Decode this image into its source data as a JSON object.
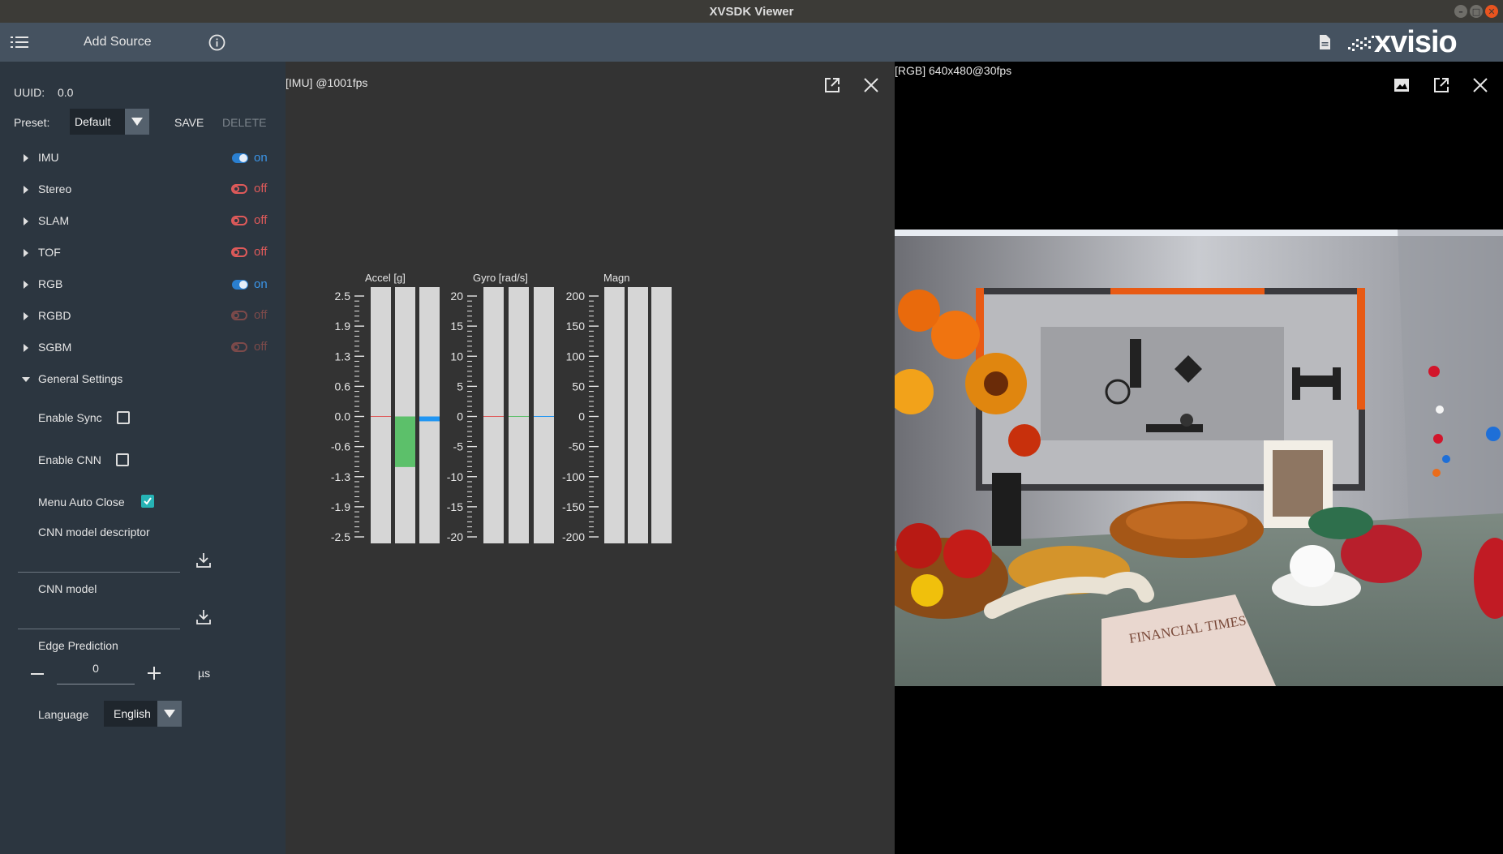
{
  "window": {
    "title": "XVSDK Viewer"
  },
  "toolbar": {
    "add_source": "Add Source",
    "logo_text": "xvisio"
  },
  "sidebar": {
    "uuid_label": "UUID:",
    "uuid_value": "0.0",
    "preset_label": "Preset:",
    "preset_value": "Default",
    "save_label": "SAVE",
    "delete_label": "DELETE",
    "streams": [
      {
        "name": "IMU",
        "state": "on"
      },
      {
        "name": "Stereo",
        "state": "off"
      },
      {
        "name": "SLAM",
        "state": "off"
      },
      {
        "name": "TOF",
        "state": "off"
      },
      {
        "name": "RGB",
        "state": "on"
      },
      {
        "name": "RGBD",
        "state": "off"
      },
      {
        "name": "SGBM",
        "state": "off"
      }
    ],
    "general_settings": "General Settings",
    "enable_sync": "Enable Sync",
    "enable_cnn": "Enable CNN",
    "menu_auto_close": "Menu Auto Close",
    "cnn_model_descriptor": "CNN model descriptor",
    "cnn_model": "CNN model",
    "edge_prediction": "Edge Prediction",
    "edge_value": "0",
    "edge_unit": "µs",
    "language_label": "Language",
    "language_value": "English",
    "colors": {
      "on": "#3b95e8",
      "off": "#e05a5a",
      "disabled": "#7d4a4a"
    }
  },
  "imu": {
    "title": "[IMU]  @1001fps",
    "accel_title": "Accel [g]",
    "gyro_title": "Gyro [rad/s]",
    "magn_title": "Magn",
    "accel_ticks": [
      "2.5",
      "1.9",
      "1.3",
      "0.6",
      "0.0",
      "-0.6",
      "-1.3",
      "-1.9",
      "-2.5"
    ],
    "gyro_ticks": [
      "20",
      "15",
      "10",
      "5",
      "0",
      "-5",
      "-10",
      "-15",
      "-20"
    ],
    "magn_ticks": [
      "200",
      "150",
      "100",
      "50",
      "0",
      "-50",
      "-100",
      "-150",
      "-200"
    ],
    "accel_values": [
      0.0,
      -1.05,
      -0.1
    ],
    "gyro_values": [
      0.0,
      0.0,
      0.0
    ],
    "axis_colors": [
      "#e05a5a",
      "#5cc06a",
      "#2196f3"
    ]
  },
  "rgb": {
    "title": "[RGB]  640x480@30fps",
    "newspaper_text": "FINANCIAL TIMES"
  }
}
